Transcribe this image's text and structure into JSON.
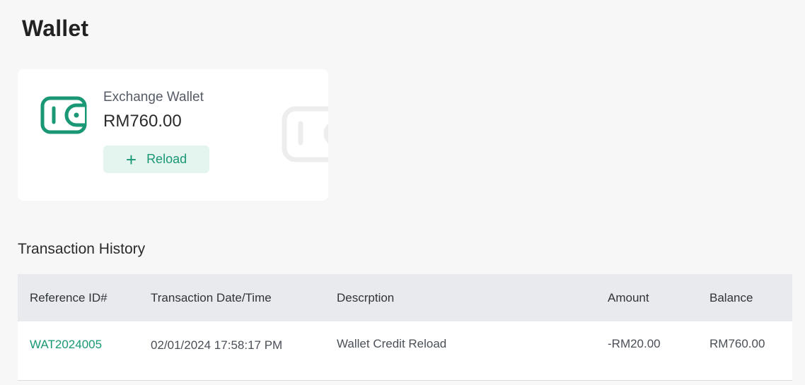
{
  "page": {
    "title": "Wallet"
  },
  "wallet": {
    "name": "Exchange Wallet",
    "balance": "RM760.00",
    "reload_label": "Reload",
    "icon": "wallet-icon",
    "accent_color": "#1a9775"
  },
  "history": {
    "title": "Transaction History",
    "columns": [
      "Reference ID#",
      "Transaction Date/Time",
      "Descrption",
      "Amount",
      "Balance"
    ],
    "rows": [
      {
        "reference_id": "WAT2024005",
        "datetime": "02/01/2024 17:58:17 PM",
        "description": "Wallet Credit Reload",
        "amount": "-RM20.00",
        "balance": "RM760.00"
      }
    ]
  }
}
